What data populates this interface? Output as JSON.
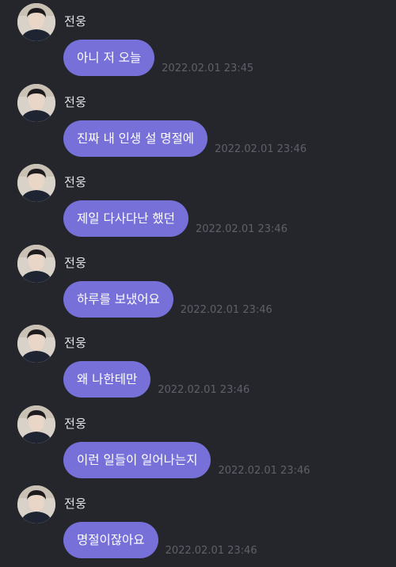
{
  "messages": [
    {
      "sender": "전웅",
      "text": "아니 저 오늘",
      "time": "2022.02.01 23:45"
    },
    {
      "sender": "전웅",
      "text": "진짜 내 인생 설 명절에",
      "time": "2022.02.01 23:46"
    },
    {
      "sender": "전웅",
      "text": "제일 다사다난 했던",
      "time": "2022.02.01 23:46"
    },
    {
      "sender": "전웅",
      "text": "하루를 보냈어요",
      "time": "2022.02.01 23:46"
    },
    {
      "sender": "전웅",
      "text": "왜 나한테만",
      "time": "2022.02.01 23:46"
    },
    {
      "sender": "전웅",
      "text": "이런 일들이 일어나는지",
      "time": "2022.02.01 23:46"
    },
    {
      "sender": "전웅",
      "text": "명절이잖아요",
      "time": "2022.02.01 23:46"
    }
  ],
  "colors": {
    "background": "#25262c",
    "bubble": "#7770d8",
    "timestamp": "#5f6069",
    "sender": "#e7e7ea"
  }
}
